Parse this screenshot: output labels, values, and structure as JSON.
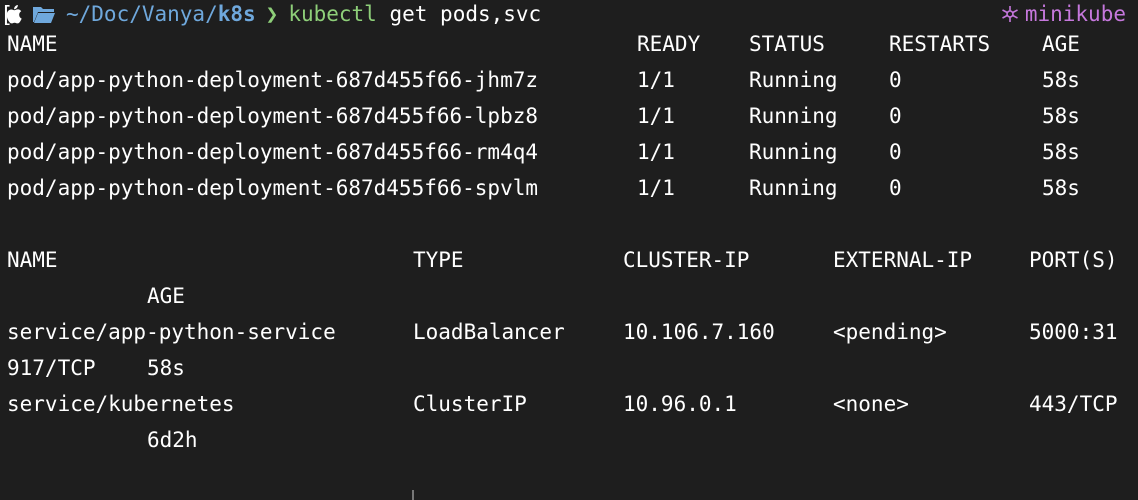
{
  "prompt": {
    "path_prefix": "~/Doc/Vanya/",
    "path_dir": "k8s",
    "command": "kubectl",
    "args": "get pods,svc",
    "context": "minikube",
    "icons": [
      "apple-icon",
      "folder-icon",
      "chevron-right-icon",
      "kubernetes-icon"
    ],
    "colors": {
      "path": "#6fa8dc",
      "command": "#8ecf79",
      "context": "#c678dd",
      "background": "#1e1e1e"
    }
  },
  "pods": {
    "headers": [
      "NAME",
      "READY",
      "STATUS",
      "RESTARTS",
      "AGE"
    ],
    "rows": [
      [
        "pod/app-python-deployment-687d455f66-jhm7z",
        "1/1",
        "Running",
        "0",
        "58s"
      ],
      [
        "pod/app-python-deployment-687d455f66-lpbz8",
        "1/1",
        "Running",
        "0",
        "58s"
      ],
      [
        "pod/app-python-deployment-687d455f66-rm4q4",
        "1/1",
        "Running",
        "0",
        "58s"
      ],
      [
        "pod/app-python-deployment-687d455f66-spvlm",
        "1/1",
        "Running",
        "0",
        "58s"
      ]
    ]
  },
  "services": {
    "headers": [
      "NAME",
      "TYPE",
      "CLUSTER-IP",
      "EXTERNAL-IP",
      "PORT(S)",
      "AGE"
    ],
    "rows": [
      {
        "name": "service/app-python-service",
        "type": "LoadBalancer",
        "cluster_ip": "10.106.7.160",
        "external_ip": "<pending>",
        "ports_part1": "5000:31",
        "ports_part2": "917/TCP",
        "age": "58s"
      },
      {
        "name": "service/kubernetes",
        "type": "ClusterIP",
        "cluster_ip": "10.96.0.1",
        "external_ip": "<none>",
        "ports_part1": "443/TCP",
        "ports_part2": "",
        "age": "6d2h"
      }
    ]
  }
}
